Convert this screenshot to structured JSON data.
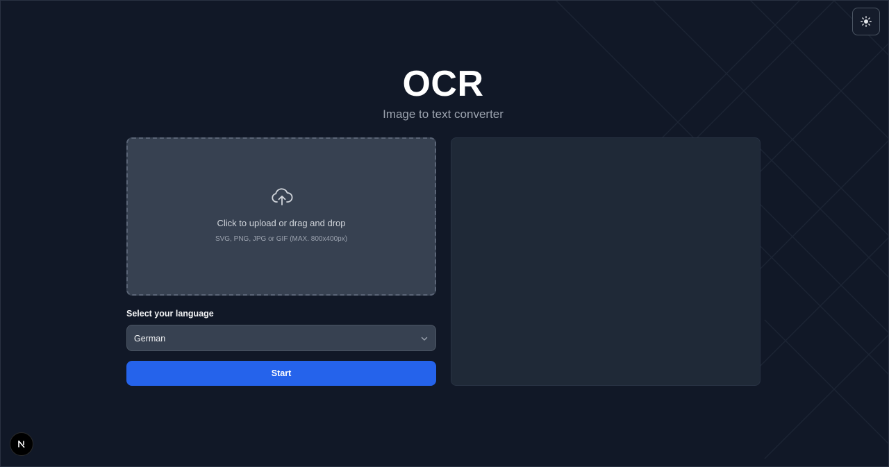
{
  "header": {
    "title": "OCR",
    "subtitle": "Image to text converter"
  },
  "theme_toggle": {
    "icon": "sun-icon"
  },
  "upload": {
    "icon": "cloud-upload-icon",
    "instruction": "Click to upload or drag and drop",
    "formats": "SVG, PNG, JPG or GIF (MAX. 800x400px)"
  },
  "language": {
    "label": "Select your language",
    "selected": "German",
    "icon": "chevron-down-icon"
  },
  "actions": {
    "start_label": "Start"
  },
  "output": {
    "text": ""
  },
  "dev_badge": {
    "icon": "nextjs-logo-icon",
    "letter": "N"
  },
  "colors": {
    "background": "#111827",
    "accent": "#2563eb",
    "dropzone": "#374151",
    "panel": "#1f2937"
  }
}
